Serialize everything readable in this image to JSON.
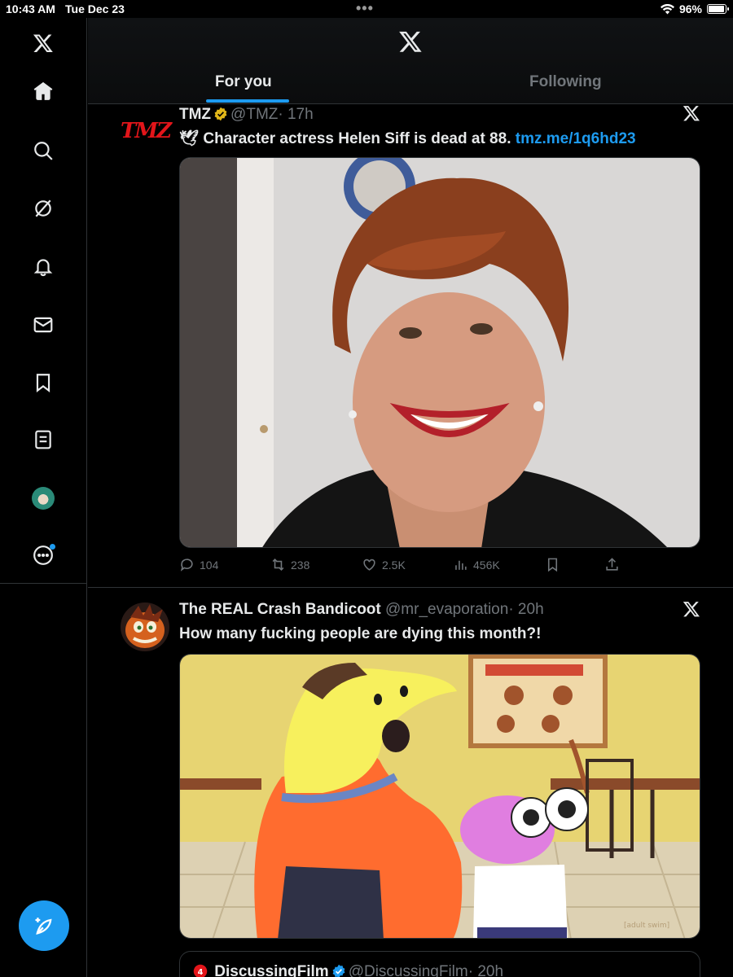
{
  "status_bar": {
    "time": "10:43 AM",
    "date": "Tue Dec 23",
    "battery": "96%",
    "battery_level": 0.96
  },
  "header": {
    "tabs": [
      {
        "label": "For you",
        "active": true
      },
      {
        "label": "Following",
        "active": false
      }
    ]
  },
  "sidebar": {
    "items": [
      "home-icon",
      "search-icon",
      "grok-icon",
      "notifications-icon",
      "messages-icon",
      "bookmarks-icon",
      "lists-icon",
      "profile-avatar",
      "more-icon"
    ],
    "compose": "compose-icon"
  },
  "tweets": [
    {
      "logo_text": "TMZ",
      "name": "TMZ",
      "handle": "@TMZ",
      "time": "· 17h",
      "emoji": "🕊",
      "text": "Character actress Helen Siff is dead at 88.",
      "link": "tmz.me/1q6hd23",
      "stats": {
        "replies": "104",
        "reposts": "238",
        "likes": "2.5K",
        "views": "456K"
      }
    },
    {
      "name": "The REAL Crash Bandicoot",
      "handle": "@mr_evaporation",
      "time": "· 20h",
      "text": "How many fucking people are dying this month?!",
      "watermark": "[adult swim]"
    }
  ],
  "quote": {
    "name": "DiscussingFilm",
    "handle": "@DiscussingFilm",
    "time": "· 20h"
  },
  "colors": {
    "accent": "#1d9bf0",
    "background": "#000000",
    "muted": "#71767b",
    "verified": "#e2b719",
    "tmz_red": "#e3151a"
  }
}
